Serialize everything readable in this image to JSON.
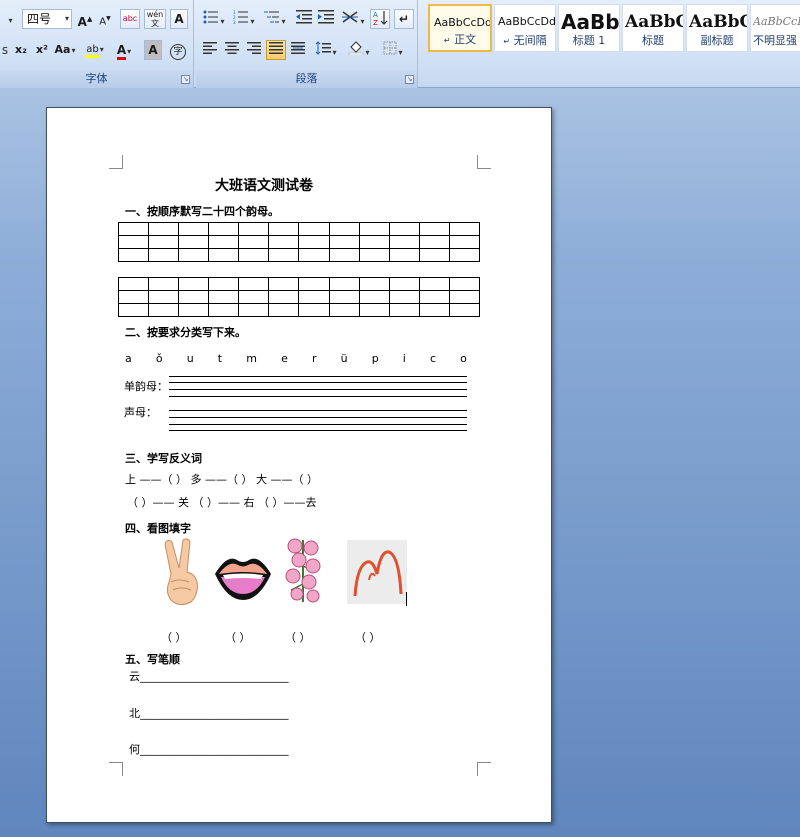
{
  "ribbon": {
    "font_group": {
      "label": "字体",
      "font_size": "四号",
      "grow_font": "A",
      "shrink_font": "A",
      "clear_format": "abc",
      "phonetic_guide": "wén",
      "char_border": "A",
      "subscript": "x₂",
      "superscript": "x²",
      "change_case": "Aa",
      "highlight": "ab",
      "font_color": "A",
      "char_shading": "A",
      "enclose_char": "字"
    },
    "paragraph_group": {
      "label": "段落"
    },
    "styles": [
      {
        "sample": "AaBbCcDd",
        "name": "正文",
        "marker": "↵",
        "selected": true
      },
      {
        "sample": "AaBbCcDd",
        "name": "无间隔",
        "marker": "↵",
        "selected": false
      },
      {
        "sample": "AaBb",
        "name": "标题 1",
        "marker": "",
        "selected": false
      },
      {
        "sample": "AaBbC",
        "name": "标题",
        "marker": "",
        "selected": false
      },
      {
        "sample": "AaBbC",
        "name": "副标题",
        "marker": "",
        "selected": false
      },
      {
        "sample": "AaBbCcDd",
        "name": "不明显强",
        "marker": "",
        "selected": false
      }
    ]
  },
  "doc": {
    "title": "大班语文测试卷",
    "section1": "一、按顺序默写二十四个韵母。",
    "section2": "二、按要求分类写下来。",
    "letters": [
      "a",
      "ǒ",
      "u",
      "t",
      "m",
      "e",
      "r",
      "ü",
      "p",
      "i",
      "c",
      "o"
    ],
    "vowel_label": "单韵母：",
    "initial_label": "声母：",
    "section3": "三、学写反义词",
    "antonym_row1": "上 ——（    ）      多 ——（    ）      大 ——（    ）",
    "antonym_row2": "（    ）—— 关      （    ）—— 右      （    ）——去",
    "section4": "四、看图填字",
    "picture_blanks": [
      "（    ）",
      "（    ）",
      "（    ）",
      "（    ）"
    ],
    "section5": "五、写笔顺",
    "stroke_lines": [
      "云___________________________",
      "北___________________________",
      "何___________________________"
    ]
  }
}
